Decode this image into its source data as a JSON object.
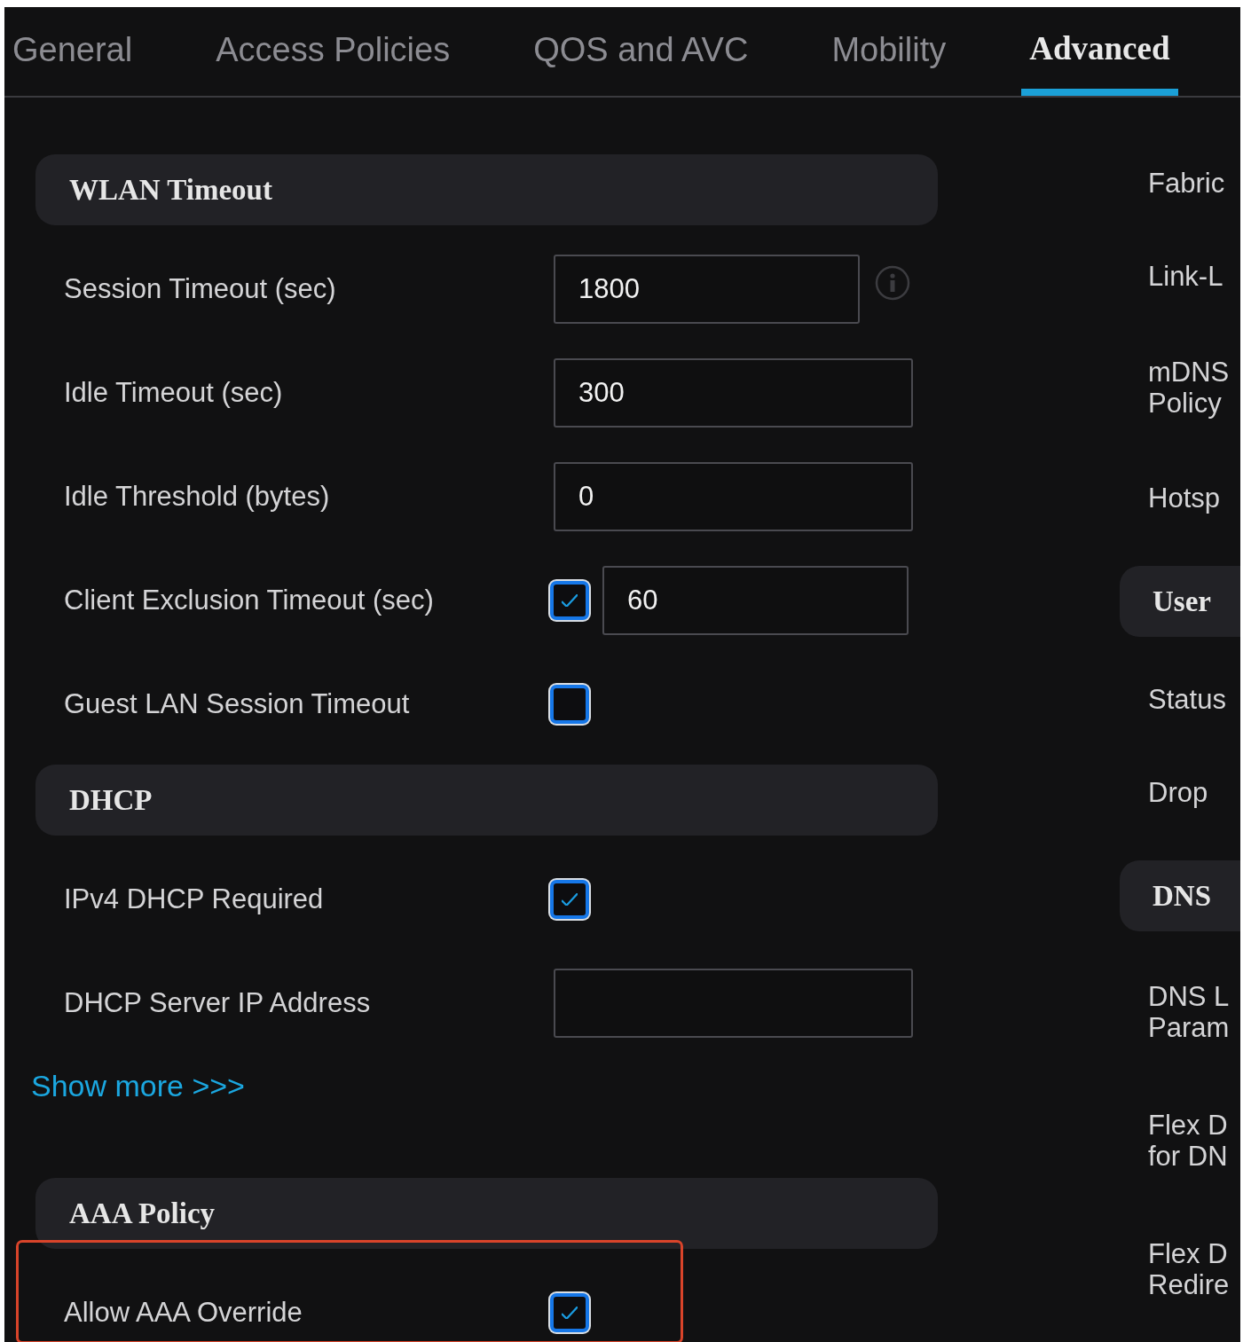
{
  "tabs": [
    {
      "label": "General",
      "selected": false
    },
    {
      "label": "Access Policies",
      "selected": false
    },
    {
      "label": "QOS and AVC",
      "selected": false
    },
    {
      "label": "Mobility",
      "selected": false
    },
    {
      "label": "Advanced",
      "selected": true
    }
  ],
  "sections": [
    {
      "title": "WLAN Timeout",
      "rows": [
        {
          "kind": "field",
          "label": "Session Timeout (sec)",
          "value": "1800",
          "info": true,
          "highlighted": false
        },
        {
          "kind": "field",
          "label": "Idle Timeout (sec)",
          "value": "300",
          "info": false,
          "highlighted": false
        },
        {
          "kind": "field",
          "label": "Idle Threshold (bytes)",
          "value": "0",
          "info": false,
          "highlighted": false
        },
        {
          "kind": "checkbox-field",
          "label": "Client Exclusion Timeout (sec)",
          "checked": true,
          "value": "60",
          "highlighted": false
        },
        {
          "kind": "checkbox",
          "label": "Guest LAN Session Timeout",
          "checked": false,
          "highlighted": false
        }
      ]
    },
    {
      "title": "DHCP",
      "rows": [
        {
          "kind": "checkbox",
          "label": "IPv4 DHCP Required",
          "checked": true,
          "highlighted": false
        },
        {
          "kind": "field",
          "label": "DHCP Server IP Address",
          "info": false,
          "highlighted": false
        }
      ],
      "link": "Show more >>>"
    },
    {
      "title": "AAA Policy",
      "rows": [
        {
          "kind": "checkbox",
          "label": "Allow AAA Override",
          "checked": true,
          "highlighted": true
        }
      ]
    }
  ],
  "right_panel": {
    "items": [
      {
        "kind": "label",
        "lines": [
          "Fabric"
        ]
      },
      {
        "kind": "label",
        "lines": [
          "Link-L"
        ]
      },
      {
        "kind": "label",
        "lines": [
          "mDNS",
          "Policy"
        ]
      },
      {
        "kind": "label",
        "lines": [
          "Hotsp"
        ]
      },
      {
        "kind": "header",
        "lines": [
          "User"
        ]
      },
      {
        "kind": "label",
        "lines": [
          "Status"
        ]
      },
      {
        "kind": "label",
        "lines": [
          "Drop"
        ]
      },
      {
        "kind": "header",
        "lines": [
          "DNS"
        ]
      },
      {
        "kind": "label",
        "lines": [
          "DNS L",
          "Param"
        ]
      },
      {
        "kind": "label",
        "lines": [
          "Flex D",
          "for DN"
        ]
      },
      {
        "kind": "label",
        "lines": [
          "Flex D",
          "Redire"
        ]
      }
    ]
  }
}
